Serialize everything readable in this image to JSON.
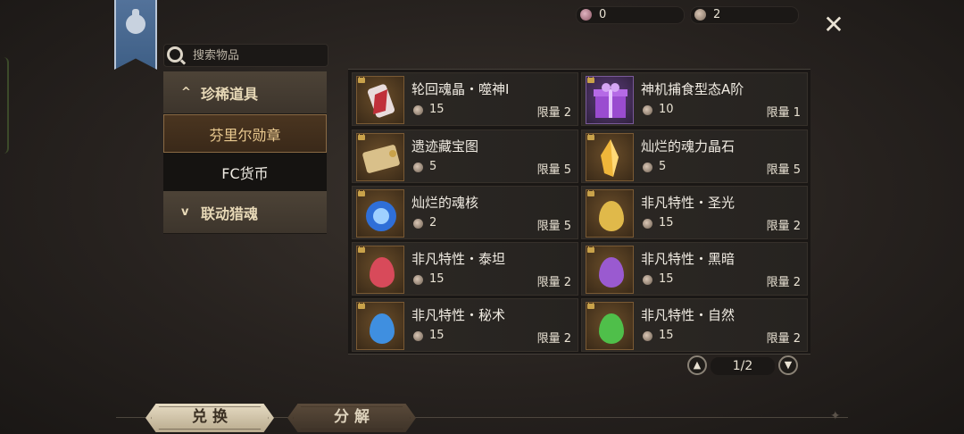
{
  "currency": {
    "red_amount": "0",
    "coin_amount": "2"
  },
  "close_label": "✕",
  "search": {
    "placeholder": "搜索物品"
  },
  "categories": [
    {
      "label": "珍稀道具",
      "chevron": "^",
      "type": "header"
    },
    {
      "label": "芬里尔勋章",
      "type": "sub",
      "active": true
    },
    {
      "label": "FC货币",
      "type": "sub",
      "active": false
    },
    {
      "label": "联动猎魂",
      "chevron": "v",
      "type": "header"
    }
  ],
  "items": [
    {
      "name": "轮回魂晶・噬神Ⅰ",
      "cost": "15",
      "limit": "限量 2",
      "icon": "red-crystal-icon"
    },
    {
      "name": "神机捕食型态A阶",
      "cost": "10",
      "limit": "限量 1",
      "icon": "purple-gift-box-icon"
    },
    {
      "name": "遗迹藏宝图",
      "cost": "5",
      "limit": "限量 5",
      "icon": "treasure-map-scroll-icon"
    },
    {
      "name": "灿烂的魂力晶石",
      "cost": "5",
      "limit": "限量 5",
      "icon": "gold-crystal-icon"
    },
    {
      "name": "灿烂的魂核",
      "cost": "2",
      "limit": "限量 5",
      "icon": "blue-soul-core-icon"
    },
    {
      "name": "非凡特性・圣光",
      "cost": "15",
      "limit": "限量 2",
      "icon": "gold-drop-gem-icon"
    },
    {
      "name": "非凡特性・泰坦",
      "cost": "15",
      "limit": "限量 2",
      "icon": "red-drop-gem-icon"
    },
    {
      "name": "非凡特性・黑暗",
      "cost": "15",
      "limit": "限量 2",
      "icon": "purple-drop-gem-icon"
    },
    {
      "name": "非凡特性・秘术",
      "cost": "15",
      "limit": "限量 2",
      "icon": "blue-drop-gem-icon"
    },
    {
      "name": "非凡特性・自然",
      "cost": "15",
      "limit": "限量 2",
      "icon": "green-drop-gem-icon"
    }
  ],
  "pagination": {
    "current": "1/2"
  },
  "tabs": {
    "exchange": "兑 换",
    "decompose": "分 解"
  },
  "colors": {
    "red_gem": "#d84a5a",
    "purple_gem": "#9a5ad0",
    "blue_gem": "#3f8fe0",
    "green_gem": "#4fbf4a",
    "gold_gem": "#e0b94a"
  }
}
